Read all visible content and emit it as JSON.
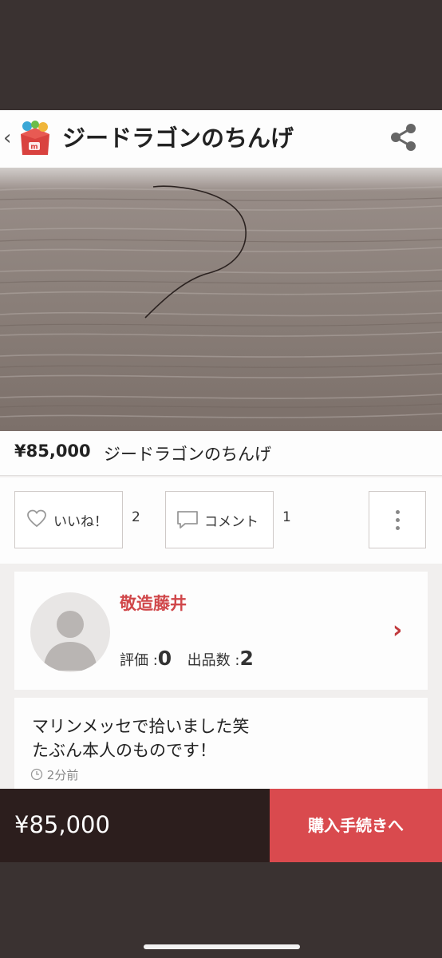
{
  "header": {
    "title": "ジードラゴンのちんげ",
    "back_icon": "‹",
    "logo_icon": "mercari-box-logo-icon",
    "share_icon": "share-icon"
  },
  "item": {
    "price": "¥85,000",
    "name": "ジードラゴンのちんげ"
  },
  "actions": {
    "like_label": "いいね！",
    "like_count": "2",
    "comment_label": "コメント",
    "comment_count": "1",
    "more_icon": "more-vertical-icon"
  },
  "seller": {
    "name": "敬造藤井",
    "rating_label": "評価 :",
    "rating_value": "0",
    "listings_label": "出品数 :",
    "listings_value": "2",
    "chevron": "›"
  },
  "description": {
    "line1": "マリンメッセで拾いました笑",
    "line2": "たぶん本人のものです！",
    "time": "2分前"
  },
  "buy_bar": {
    "price": "¥85,000",
    "button_label": "購入手続きへ"
  },
  "colors": {
    "accent_red": "#d94a4e",
    "seller_name_red": "#d0474a",
    "buy_bar_dark": "#2c1e1d",
    "frame_dark": "#3a3231"
  }
}
